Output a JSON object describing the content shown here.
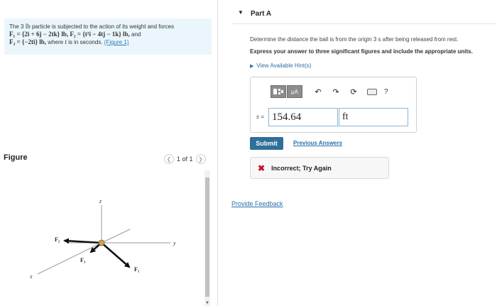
{
  "problem": {
    "intro": "The 3",
    "weight_unit": "lb",
    "mid1": "particle is subjected to the action of its weight and forces",
    "f1": "F₁ = {2i + 6j − 2tk} lb,",
    "f2": "F₂ = {t²i − 4tj − 1k} lb,",
    "and": "and",
    "f3": "F₃ = {−2ti} lb,",
    "mid2": "where",
    "t_var": "t",
    "mid3": "is in seconds.",
    "figure_link": "(Figure 1)"
  },
  "figure": {
    "label": "Figure",
    "pager_text": "1 of 1",
    "prev_icon": "chevron-left-icon",
    "next_icon": "chevron-right-icon",
    "axis_labels": {
      "z": "z",
      "y": "y",
      "x": "x"
    },
    "force_labels": {
      "f1": "F₁",
      "f2": "F₂",
      "f3": "F₃"
    }
  },
  "part": {
    "title": "Part A",
    "question": "Determine the distance the ball is from the origin 3 s after being released from rest.",
    "instruction": "Express your answer to three significant figures and include the appropriate units.",
    "hint": "View Available Hint(s)"
  },
  "answer": {
    "var_label": "s =",
    "value": "154.64",
    "units": "ft",
    "toolbar": {
      "templates_icon": "templates-icon",
      "units_label": "μA",
      "undo_icon": "undo-icon",
      "redo_icon": "redo-icon",
      "reset_icon": "reset-icon",
      "keyboard_icon": "keyboard-icon",
      "help": "?"
    }
  },
  "actions": {
    "submit": "Submit",
    "previous_answers": "Previous Answers"
  },
  "feedback": {
    "icon": "✖",
    "message": "Incorrect; Try Again"
  },
  "footer": {
    "provide_feedback": "Provide Feedback"
  },
  "colors": {
    "problem_bg": "#eaf6fb",
    "submit_bg": "#2f6f99",
    "link": "#2a6fa8",
    "incorrect": "#c8102e"
  }
}
